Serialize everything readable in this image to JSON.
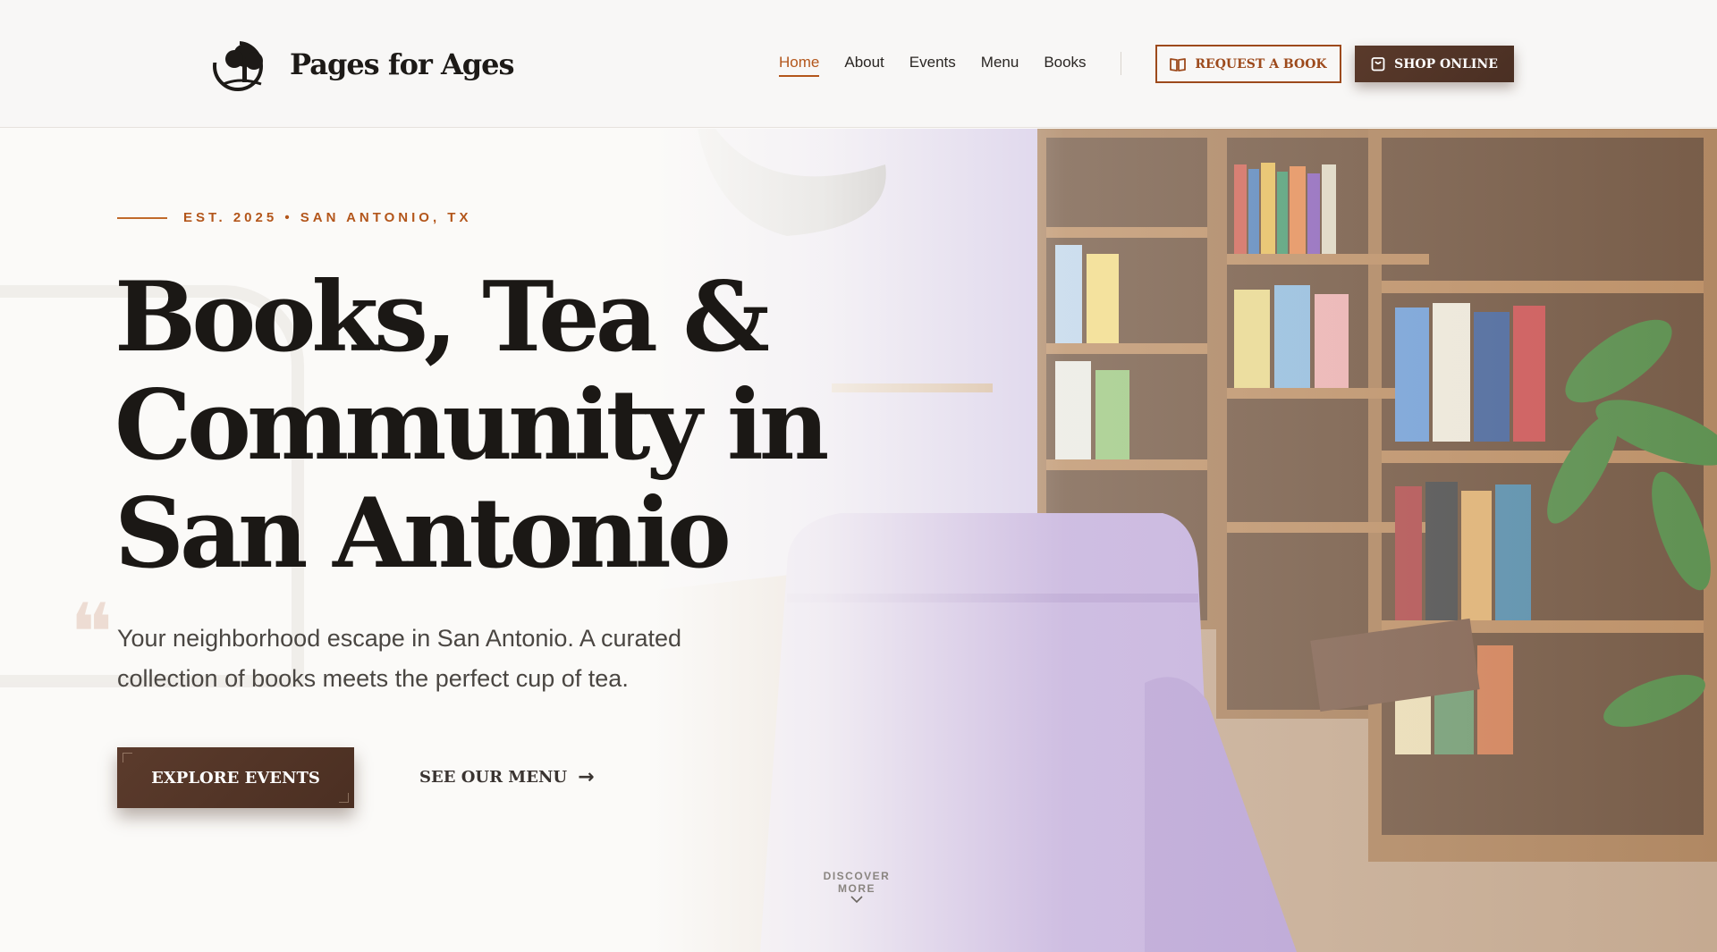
{
  "header": {
    "brand": "Pages for Ages",
    "nav": [
      "Home",
      "About",
      "Events",
      "Menu",
      "Books"
    ],
    "active_nav": "Home",
    "request_label": "REQUEST A BOOK",
    "shop_label": "SHOP ONLINE"
  },
  "hero": {
    "eyebrow": "EST. 2025 • SAN ANTONIO, TX",
    "headline_part1": "Books, ",
    "headline_highlight": "Tea",
    "headline_part2": " & Community in San Antonio",
    "subtext": "Your neighborhood escape in San Antonio. A curated collection of books meets the perfect cup of tea.",
    "primary_cta": "EXPLORE EVENTS",
    "secondary_cta": "SEE OUR MENU",
    "discover": "DISCOVER MORE"
  },
  "colors": {
    "accent": "#b3561b",
    "brown": "#4e3226",
    "highlight": "#fbeeb4"
  },
  "icons": [
    "logo-tree-icon",
    "book-icon",
    "shopping-bag-icon",
    "arrow-right-icon",
    "chevron-down-icon",
    "quote-icon"
  ]
}
